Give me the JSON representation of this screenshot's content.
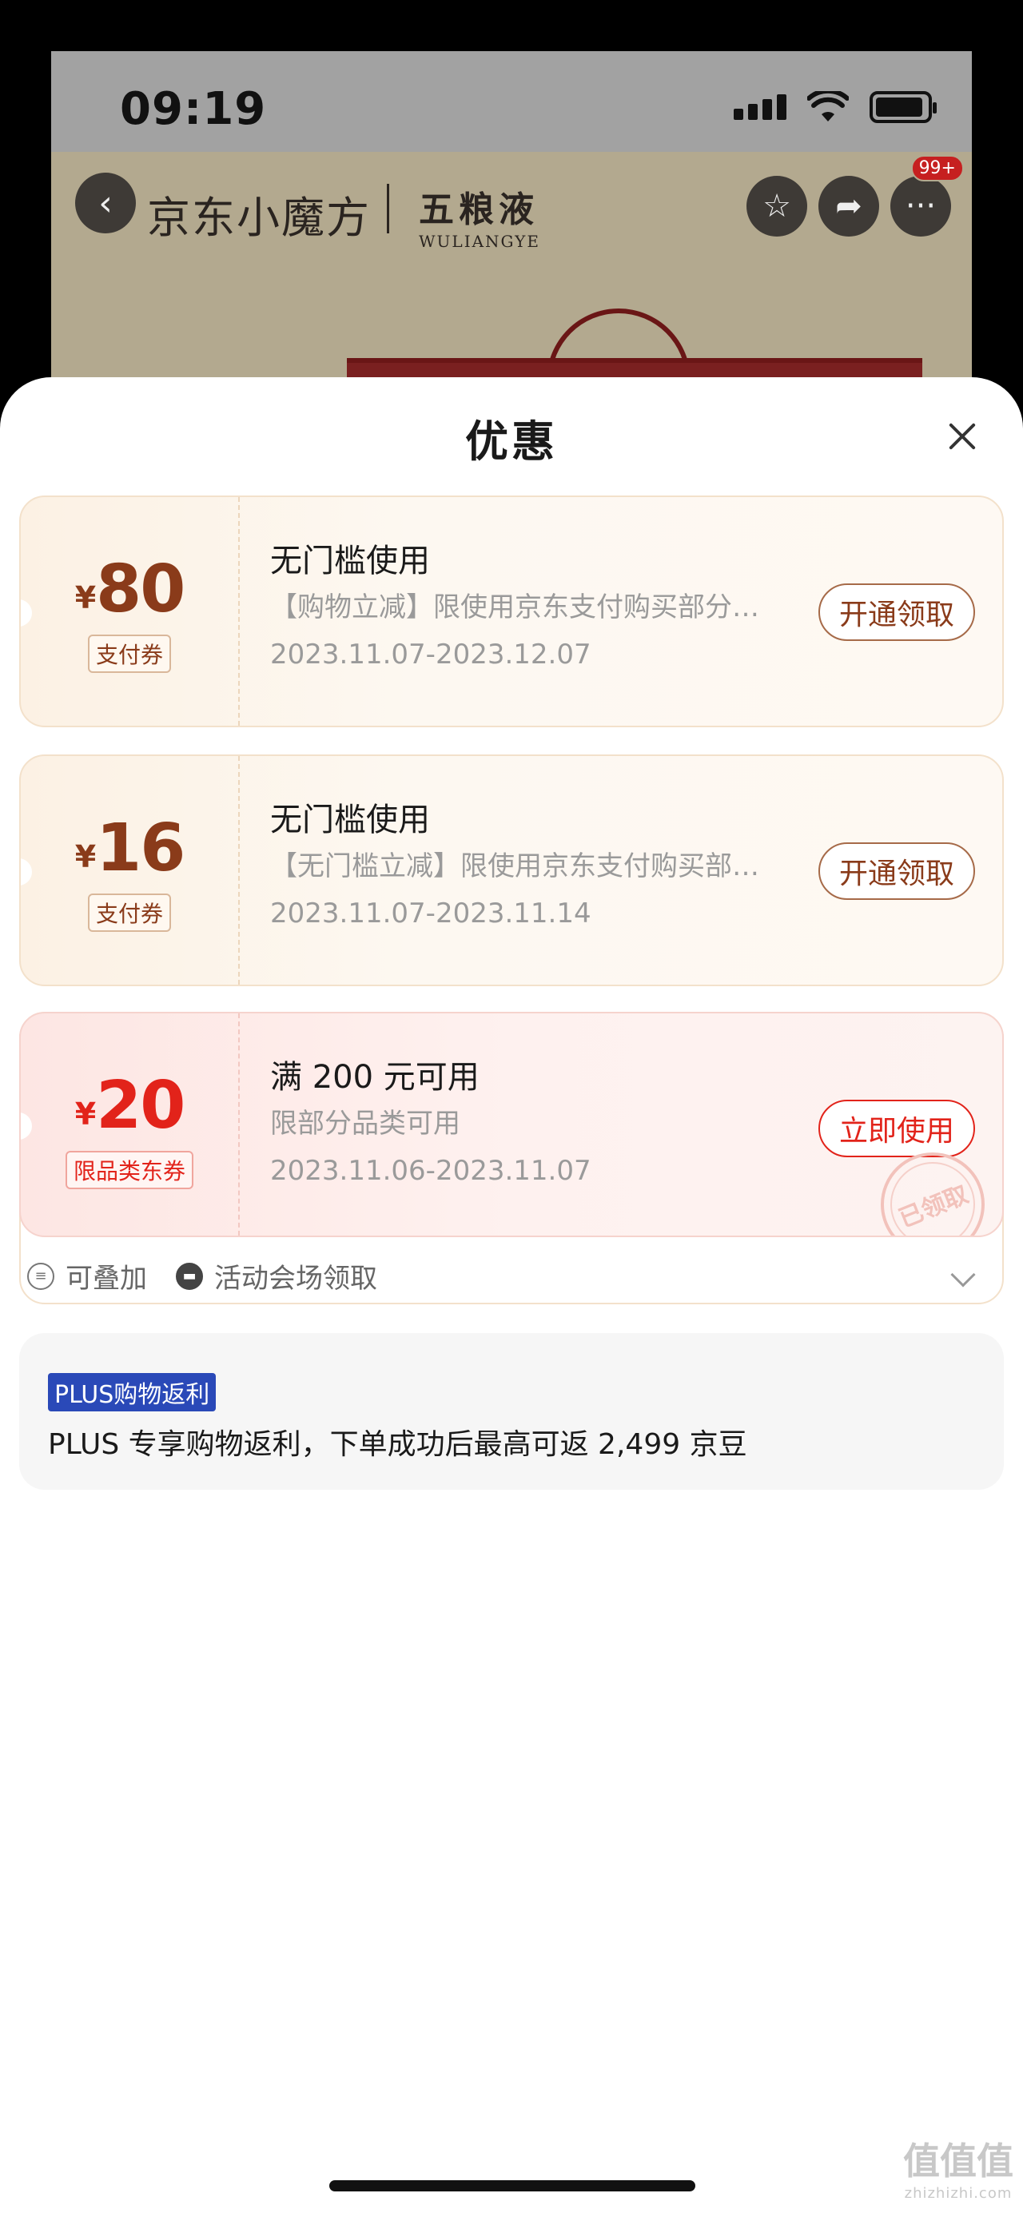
{
  "status_bar": {
    "time": "09:19"
  },
  "app_header": {
    "brand": "京东小魔方",
    "partner_cn": "五粮液",
    "partner_en": "WULIANGYE",
    "notification_badge": "99+"
  },
  "sheet": {
    "title": "优惠",
    "coupons": [
      {
        "style": "gold",
        "currency": "¥",
        "amount": "80",
        "tag": "支付券",
        "title": "无门槛使用",
        "desc": "【购物立减】限使用京东支付购买部分商品",
        "date": "2023.11.07-2023.12.07",
        "action": "开通领取"
      },
      {
        "style": "gold",
        "currency": "¥",
        "amount": "16",
        "tag": "支付券",
        "title": "无门槛使用",
        "desc": "【无门槛立减】限使用京东支付购买部分商品",
        "date": "2023.11.07-2023.11.14",
        "action": "开通领取"
      },
      {
        "style": "red",
        "currency": "¥",
        "amount": "20",
        "tag": "限品类东券",
        "title": "满 200 元可用",
        "desc": "限部分品类可用",
        "date": "2023.11.06-2023.11.07",
        "action": "立即使用",
        "stamp": "已领取"
      }
    ],
    "footer_tags": [
      "可叠加",
      "活动会场领取"
    ],
    "plus": {
      "badge": "PLUS购物返利",
      "text": "PLUS 专享购物返利，下单成功后最高可返 2,499 京豆"
    }
  },
  "watermark": {
    "main": "值值值",
    "sub": "zhizhizhi.com"
  },
  "colors": {
    "gold_accent": "#8a3b1a",
    "red_accent": "#e2231a",
    "plus_blue": "#2a49b8"
  }
}
